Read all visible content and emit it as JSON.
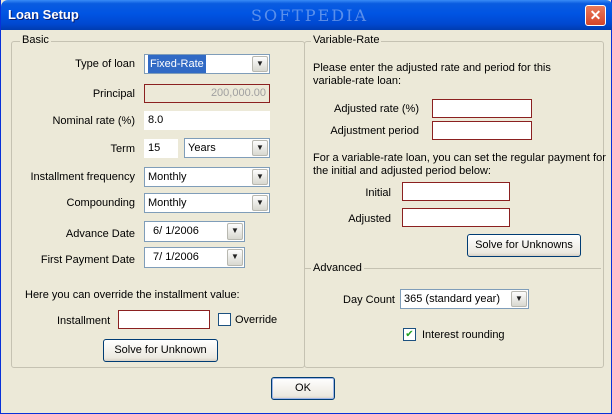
{
  "window": {
    "title": "Loan Setup",
    "watermark": "SOFTPEDIA",
    "close_symbol": "✕"
  },
  "basic": {
    "title": "Basic",
    "type_of_loan": {
      "label": "Type of loan",
      "value": "Fixed-Rate"
    },
    "principal": {
      "label": "Principal",
      "value": "200,000.00"
    },
    "nominal_rate": {
      "label": "Nominal rate (%)",
      "value": "8.0"
    },
    "term": {
      "label": "Term",
      "value": "15",
      "unit": "Years"
    },
    "installment_frequency": {
      "label": "Installment frequency",
      "value": "Monthly"
    },
    "compounding": {
      "label": "Compounding",
      "value": "Monthly"
    },
    "advance_date": {
      "label": "Advance Date",
      "value": "6/ 1/2006"
    },
    "first_payment_date": {
      "label": "First Payment Date",
      "value": "7/ 1/2006"
    },
    "override_note": "Here you can override the installment value:",
    "installment": {
      "label": "Installment",
      "value": ""
    },
    "override_label": "Override",
    "solve_button": "Solve for Unknown"
  },
  "variable_rate": {
    "title": "Variable-Rate",
    "note1": "Please enter the adjusted rate and period for this",
    "note2": "variable-rate loan:",
    "adjusted_rate_label": "Adjusted rate (%)",
    "adjustment_period_label": "Adjustment period",
    "note3": "For a variable-rate loan, you can set the regular payment for",
    "note4": "the initial and adjusted period below:",
    "initial_label": "Initial",
    "adjusted_label": "Adjusted",
    "solve_button": "Solve for Unknowns"
  },
  "advanced": {
    "title": "Advanced",
    "day_count_label": "Day Count",
    "day_count_value": "365 (standard year)",
    "interest_rounding_label": "Interest rounding",
    "interest_rounding_checked": "✔"
  },
  "ok_button": "OK",
  "dropdown_arrow": "▼"
}
